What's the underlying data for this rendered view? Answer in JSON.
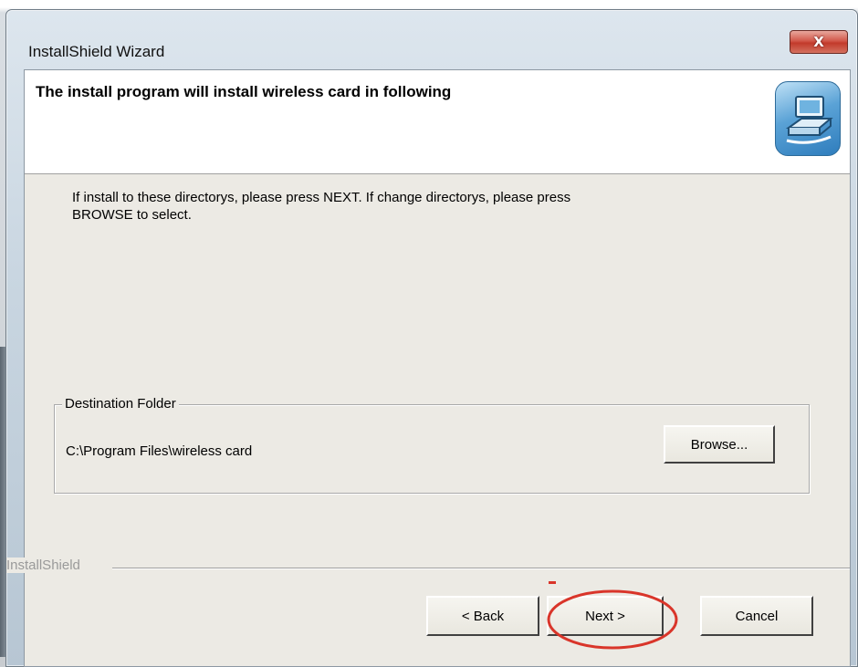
{
  "window": {
    "title": "InstallShield Wizard",
    "close_label": "X"
  },
  "header": {
    "title": "The install program will install wireless card in following",
    "icon": "computer-setup-icon"
  },
  "instructions": {
    "line1": "If install to these directorys, please press NEXT. If change directorys, please press",
    "line2": "BROWSE to select."
  },
  "destination": {
    "legend": "Destination Folder",
    "path": "C:\\Program Files\\wireless card",
    "browse_label": "Browse..."
  },
  "footer": {
    "brand": "InstallShield",
    "back_label": "< Back",
    "next_label": "Next >",
    "cancel_label": "Cancel"
  },
  "colors": {
    "annotation": "#d9352a",
    "close_button": "#c23a2b"
  }
}
